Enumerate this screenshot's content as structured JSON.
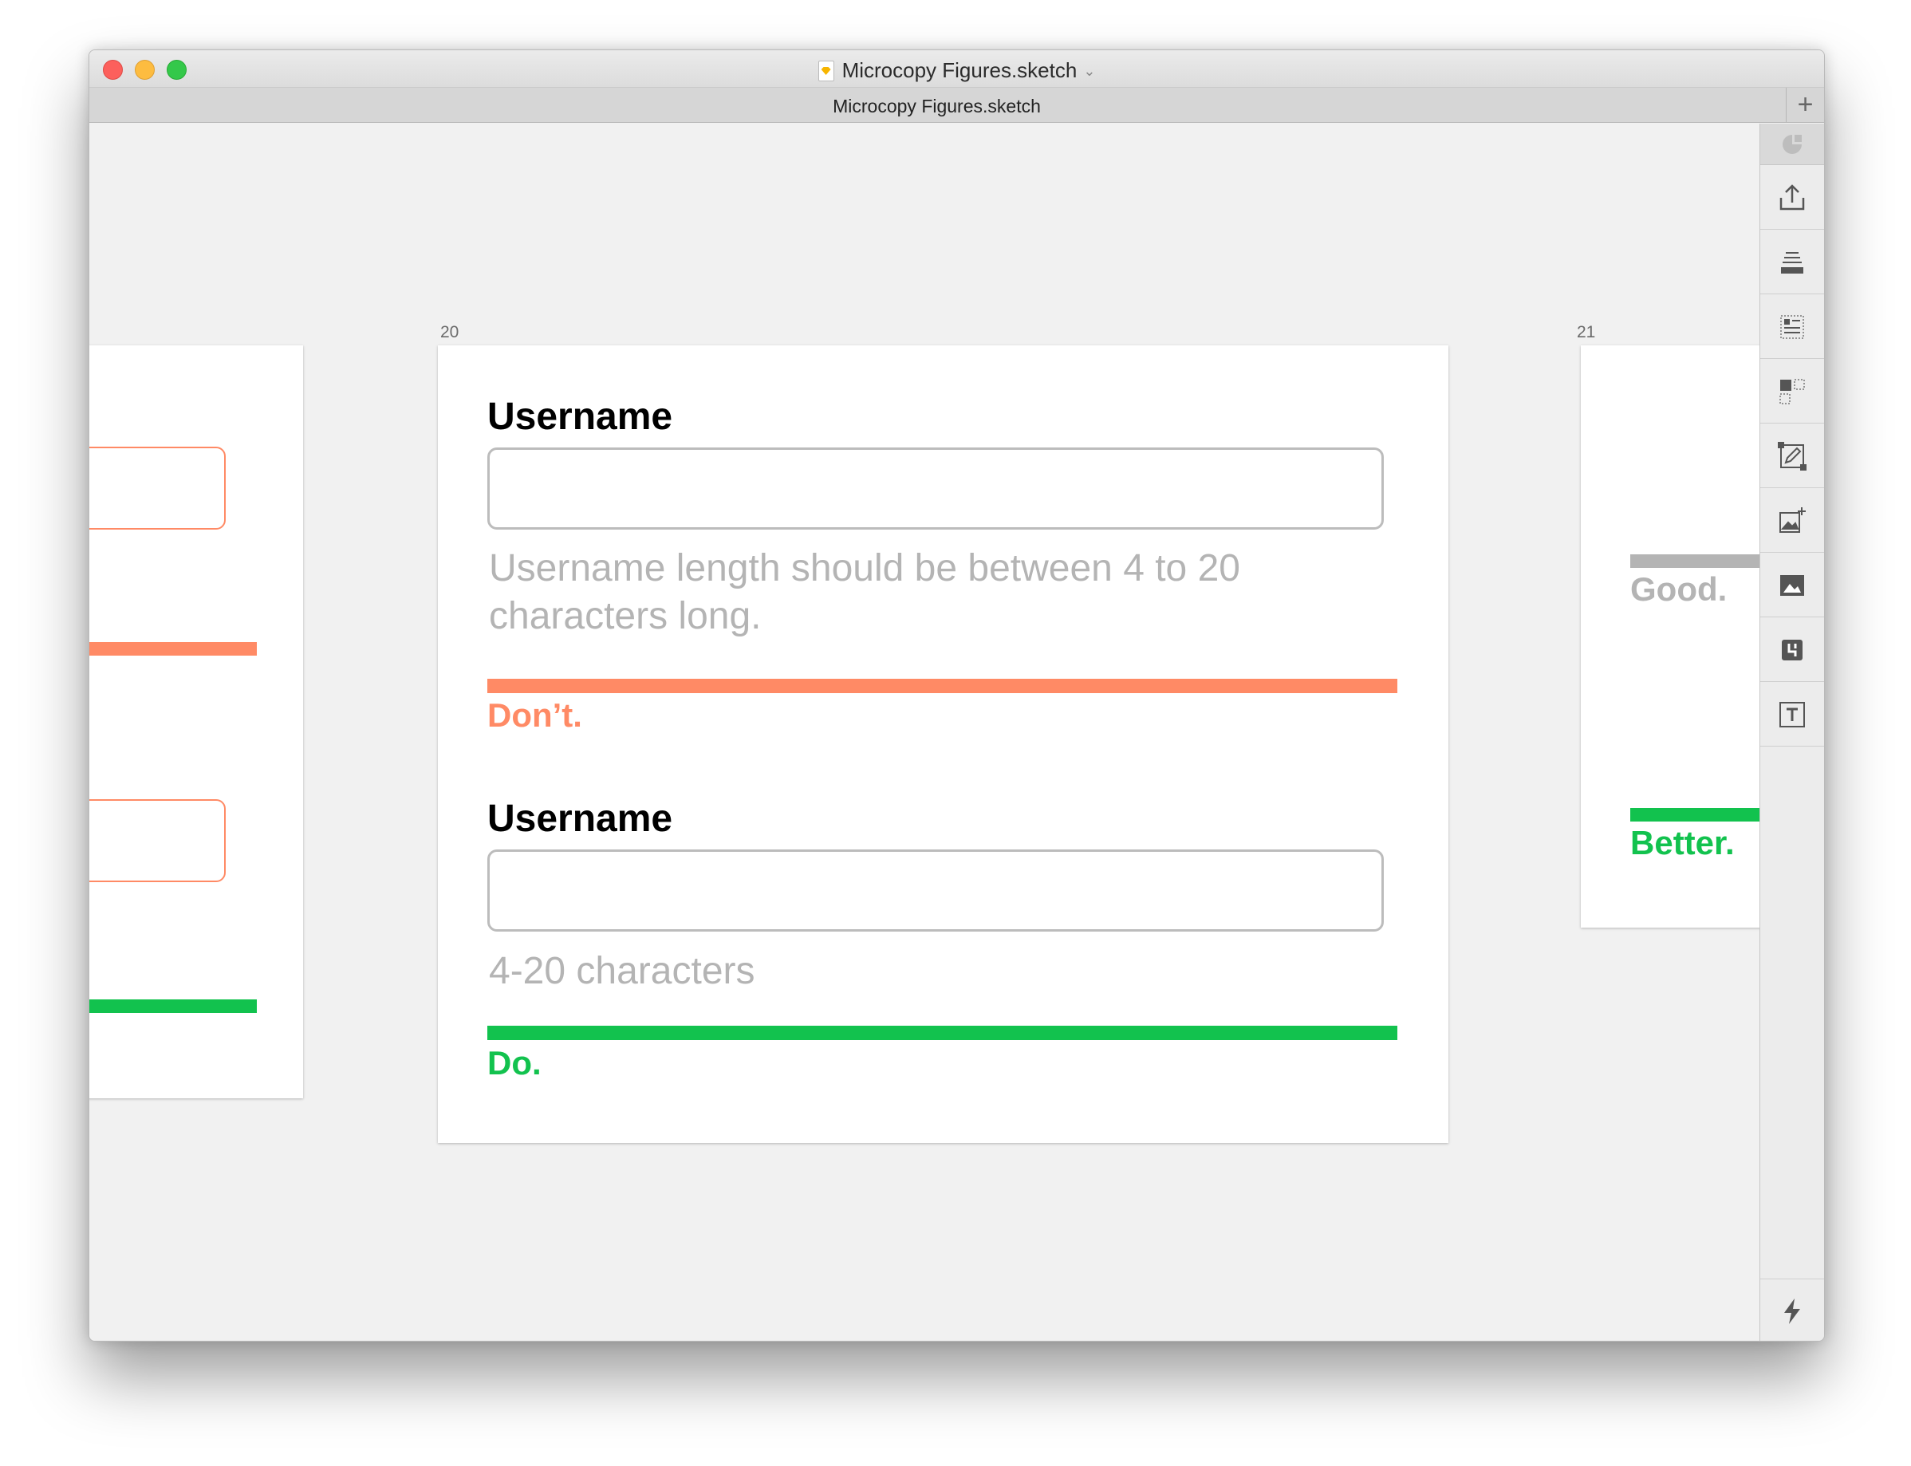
{
  "window": {
    "title": "Microcopy Figures.sketch",
    "tab_label": "Microcopy Figures.sketch",
    "add_tab_label": "+"
  },
  "artboards": {
    "main_number": "20",
    "right_number": "21"
  },
  "examples": [
    {
      "label": "Username",
      "helper_text": "Username length should be between 4 to 20 characters long.",
      "verdict": "Don’t.",
      "verdict_color": "#ff8a65"
    },
    {
      "label": "Username",
      "helper_text": "4-20 characters",
      "verdict": "Do.",
      "verdict_color": "#12c24e"
    }
  ],
  "right_artboard": {
    "verdict_1": "Good.",
    "verdict_1_color": "#b4b4b4",
    "verdict_2": "Better.",
    "verdict_2_color": "#12c24e"
  },
  "inspector_icons": [
    "color-icon",
    "export-icon",
    "align-icon",
    "text-list-icon",
    "select-group-icon",
    "edit-shape-icon",
    "add-image-icon",
    "image-icon",
    "symbol-icon",
    "text-tool-icon",
    "lightning-icon"
  ]
}
